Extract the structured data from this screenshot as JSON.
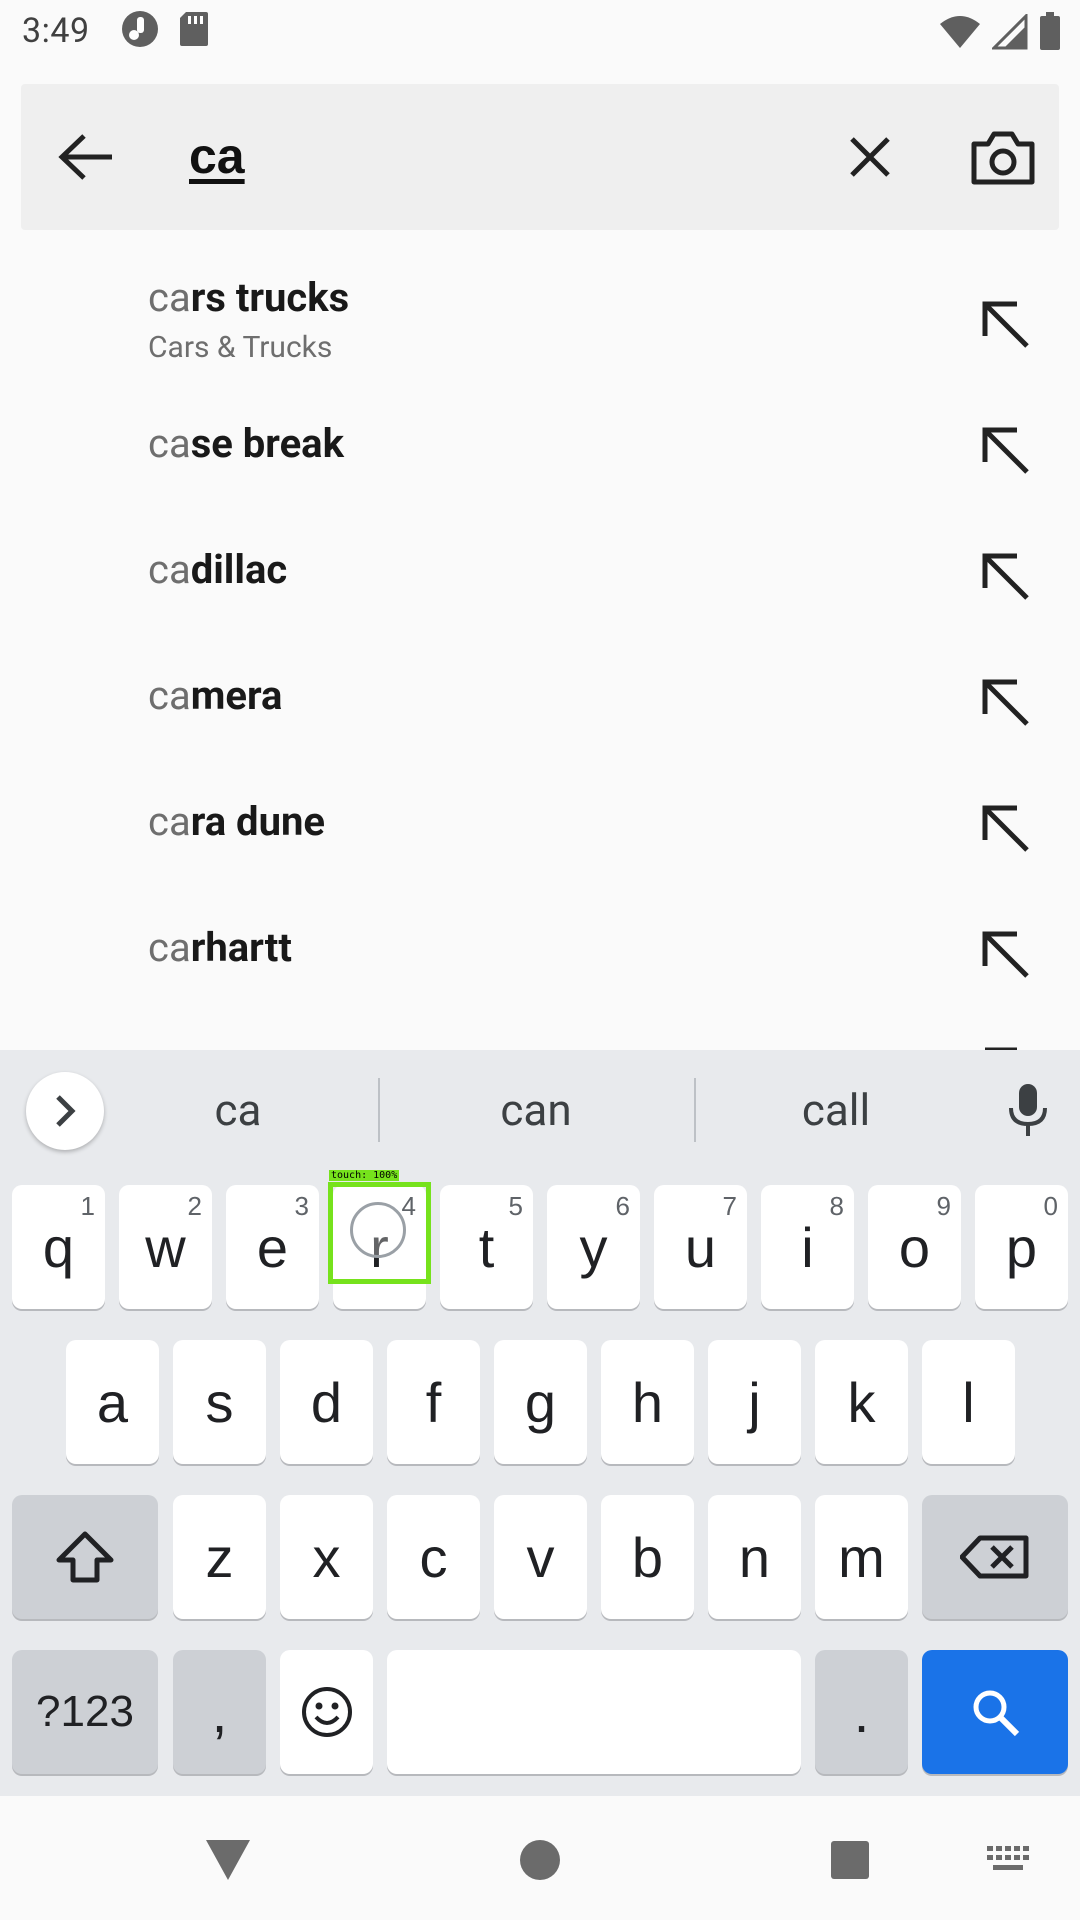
{
  "status_bar": {
    "time": "3:49"
  },
  "search": {
    "query": "ca",
    "placeholder": ""
  },
  "suggestions": [
    {
      "typed": "ca",
      "rest": "rs trucks",
      "category": "Cars & Trucks"
    },
    {
      "typed": "ca",
      "rest": "se break",
      "category": ""
    },
    {
      "typed": "ca",
      "rest": "dillac",
      "category": ""
    },
    {
      "typed": "ca",
      "rest": "mera",
      "category": ""
    },
    {
      "typed": "ca",
      "rest": "ra dune",
      "category": ""
    },
    {
      "typed": "ca",
      "rest": "rhartt",
      "category": ""
    }
  ],
  "keyboard": {
    "suggestions": [
      "ca",
      "can",
      "call"
    ],
    "row1": [
      {
        "key": "q",
        "hint": "1"
      },
      {
        "key": "w",
        "hint": "2"
      },
      {
        "key": "e",
        "hint": "3"
      },
      {
        "key": "r",
        "hint": "4"
      },
      {
        "key": "t",
        "hint": "5"
      },
      {
        "key": "y",
        "hint": "6"
      },
      {
        "key": "u",
        "hint": "7"
      },
      {
        "key": "i",
        "hint": "8"
      },
      {
        "key": "o",
        "hint": "9"
      },
      {
        "key": "p",
        "hint": "0"
      }
    ],
    "row2": [
      "a",
      "s",
      "d",
      "f",
      "g",
      "h",
      "j",
      "k",
      "l"
    ],
    "row3": [
      "z",
      "x",
      "c",
      "v",
      "b",
      "n",
      "m"
    ],
    "symbols_label": "?123",
    "comma": ",",
    "period": ".",
    "touch_label": "touch: 100%"
  },
  "colors": {
    "accent": "#1a73e8",
    "touch": "#76e21c"
  }
}
